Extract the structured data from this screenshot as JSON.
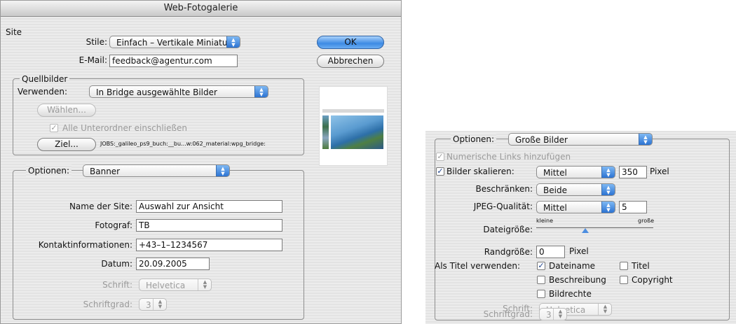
{
  "dialog_left": {
    "title": "Web-Fotogalerie",
    "site": {
      "group_label": "Site",
      "stile_label": "Stile:",
      "stile_value": "Einfach – Vertikale Miniatu...",
      "email_label": "E-Mail:",
      "email_value": "feedback@agentur.com"
    },
    "buttons": {
      "ok": "OK",
      "cancel": "Abbrechen"
    },
    "quellbilder": {
      "group_label": "Quellbilder",
      "verwenden_label": "Verwenden:",
      "verwenden_value": "In Bridge ausgewählte Bilder",
      "waehlen_button": "Wählen...",
      "subfolders_label": "Alle Unterordner einschließen",
      "subfolders_checked": true,
      "ziel_button": "Ziel...",
      "ziel_path": "JOBS:_galileo_ps9_buch:__bu...w:062_material:wpg_bridge:"
    },
    "optionen": {
      "label": "Optionen:",
      "value": "Banner",
      "site_name_label": "Name der Site:",
      "site_name_value": "Auswahl zur Ansicht",
      "fotograf_label": "Fotograf:",
      "fotograf_value": "TB",
      "kontakt_label": "Kontaktinformationen:",
      "kontakt_value": "+43–1–1234567",
      "datum_label": "Datum:",
      "datum_value": "20.09.2005",
      "schrift_label": "Schrift:",
      "schrift_value": "Helvetica",
      "schriftgrad_label": "Schriftgrad:",
      "schriftgrad_value": "3"
    }
  },
  "panel_right": {
    "label": "Optionen:",
    "value": "Große Bilder",
    "numeric_links_label": "Numerische Links hinzufügen",
    "numeric_links_checked": true,
    "scale_label": "Bilder skalieren:",
    "scale_checked": true,
    "scale_value": "Mittel",
    "scale_pixels": "350",
    "pixel_unit": "Pixel",
    "constrain_label": "Beschränken:",
    "constrain_value": "Beide",
    "jpeg_label": "JPEG-Qualität:",
    "jpeg_value": "Mittel",
    "jpeg_number": "5",
    "filesize_label": "Dateigröße:",
    "filesize_small": "kleine",
    "filesize_large": "große",
    "filesize_level": 0.42,
    "border_label": "Randgröße:",
    "border_value": "0",
    "border_unit": "Pixel",
    "title_use_label": "Als Titel verwenden:",
    "title_options": {
      "dateiname": "Dateiname",
      "titel": "Titel",
      "beschreibung": "Beschreibung",
      "copyright": "Copyright",
      "bildrechte": "Bildrechte"
    },
    "schrift_label": "Schrift:",
    "schrift_value": "Helvetica",
    "schriftgrad_label": "Schriftgrad:",
    "schriftgrad_value": "3"
  },
  "colors": {
    "accent": "#3d8ae4",
    "stripe": "#ececec"
  },
  "icons": [
    "popup-arrows-icon",
    "checkmark-icon",
    "stepper-icon",
    "slider-thumb-icon",
    "preview-image"
  ]
}
